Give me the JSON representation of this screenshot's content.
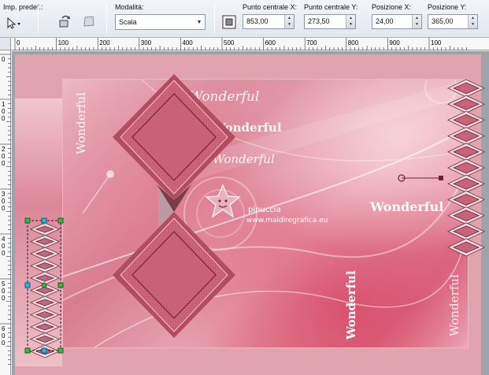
{
  "toolbar": {
    "preset_label": "Imp. predef.:",
    "mode_label": "Modalità:",
    "mode_value": "Scala",
    "center_x_label": "Punto centrale X:",
    "center_x_value": "853,00",
    "center_y_label": "Punto centrale Y:",
    "center_y_value": "273,50",
    "pos_x_label": "Posizione X:",
    "pos_x_value": "24,00",
    "pos_y_label": "Posizione Y:",
    "pos_y_value": "365,00"
  },
  "ruler": {
    "h_labels": [
      "0",
      "100",
      "200",
      "300",
      "400",
      "500",
      "600",
      "700",
      "800",
      "900",
      "100"
    ],
    "v_labels": [
      "0",
      "1\n0\n0",
      "2\n0\n0",
      "3\n0\n0",
      "4\n0\n0",
      "5\n0\n0",
      "6\n0\n0"
    ]
  },
  "canvas": {
    "wonderful_texts": [
      "Wonderful",
      "Wonderful",
      "Wonderful",
      "Wonderful",
      "Wonderful",
      "Wonderful",
      "Wonderful",
      "Wonderful"
    ],
    "watermark_line1": "pinuccia",
    "watermark_line2": "www.maidiregrafica.eu"
  },
  "colors": {
    "accent_pink": "#d77d8f",
    "outer_frame": "#e1a3ad",
    "diamond_fill": "#c85f73",
    "handle_green": "#39b54a",
    "handle_cyan": "#2ab5d8"
  },
  "icons": [
    "pick-tool-icon",
    "preset-icon",
    "mode-icon",
    "center-icon",
    "spin-up-icon",
    "spin-down-icon"
  ]
}
